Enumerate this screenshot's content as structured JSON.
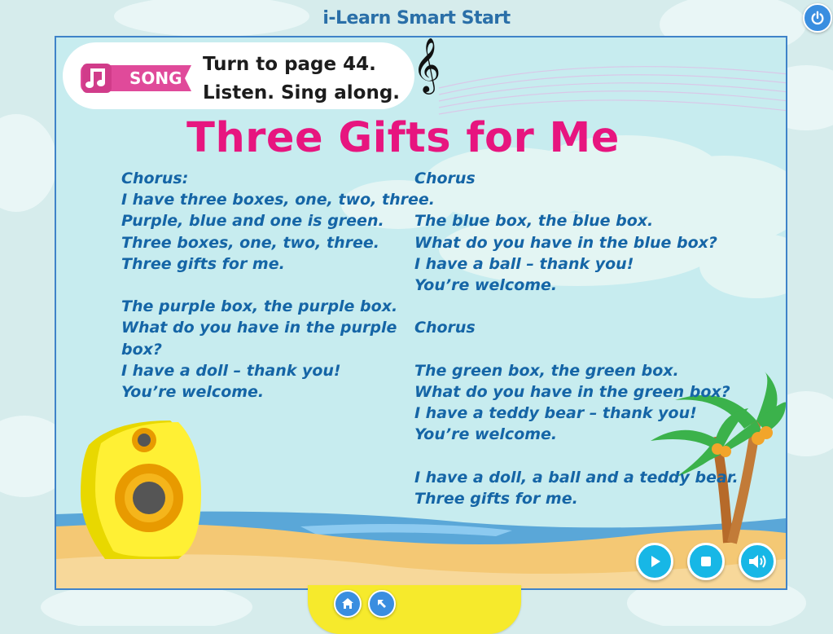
{
  "app": {
    "title": "i-Learn Smart Start"
  },
  "activity": {
    "badge_label": "SONG",
    "instruction_line1": "Turn to page 44.",
    "instruction_line2": "Listen. Sing along."
  },
  "song": {
    "title": "Three Gifts for Me",
    "left_column": [
      "Chorus:",
      "I have three boxes, one, two, three.",
      "Purple, blue and one is green.",
      "Three boxes, one, two, three.",
      "Three gifts for me.",
      "",
      "The purple box, the purple box.",
      "What do you have in the purple",
      "box?",
      "I have a doll – thank you!",
      "You’re welcome."
    ],
    "right_column": [
      "Chorus",
      "",
      "The blue box, the blue box.",
      "What do you have in the blue box?",
      "I have a ball – thank you!",
      "You’re welcome.",
      "",
      "Chorus",
      "",
      "The green box, the green box.",
      "What do you have in the green box?",
      "I have a teddy bear – thank you!",
      "You’re welcome.",
      "",
      "I have a doll, a ball and a teddy bear.",
      "Three gifts for me."
    ]
  },
  "controls": {
    "play_icon": "play-icon",
    "stop_icon": "stop-icon",
    "volume_icon": "volume-icon"
  },
  "navigation": {
    "home_icon": "home-icon",
    "back_icon": "back-arrow-icon",
    "power_icon": "power-icon"
  },
  "colors": {
    "title_blue": "#2a6fa8",
    "song_title_pink": "#e7157f",
    "lyrics_blue": "#1565a6",
    "badge_pink": "#e04a9a",
    "button_blue": "#17b7e6",
    "bar_yellow": "#f6ea2c"
  }
}
